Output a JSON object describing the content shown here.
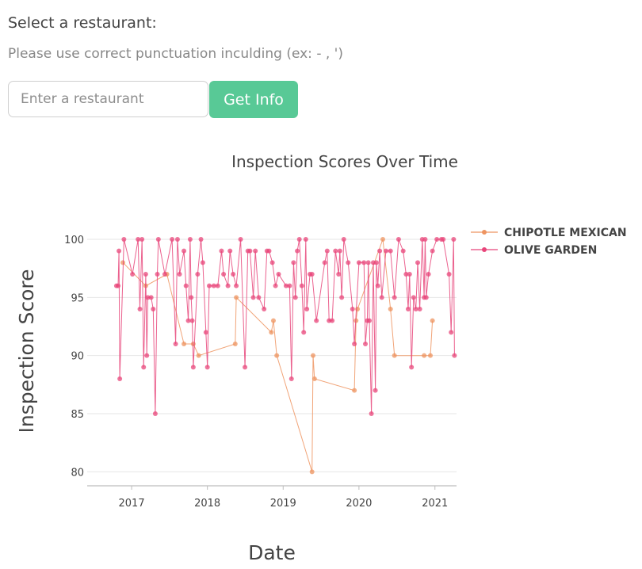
{
  "form": {
    "heading": "Select a restaurant:",
    "subheading": "Please use correct punctuation inculding (ex: - , ')",
    "search_placeholder": "Enter a restaurant",
    "button_label": "Get Info"
  },
  "colors": {
    "accent_button": "#58c996",
    "series_chipotle": "#ee9460",
    "series_olive": "#e8457a",
    "grid": "#e6e6e6",
    "axis": "#bdbdbd"
  },
  "chart_data": {
    "type": "line",
    "title": "Inspection Scores Over Time",
    "xlabel": "Date",
    "ylabel": "Inspection Score",
    "xlim": [
      "2016-06-01",
      "2021-04-15"
    ],
    "ylim": [
      79,
      101.5
    ],
    "yticks": [
      80,
      85,
      90,
      95,
      100
    ],
    "xticks": [
      "2017",
      "2018",
      "2019",
      "2020",
      "2021"
    ],
    "grid": "horizontal",
    "markers": true,
    "legend_position": "top-right",
    "series": [
      {
        "name": "CHIPOTLE MEXICAN",
        "color": "#ee9460",
        "points": [
          [
            "2016-11-20",
            98
          ],
          [
            "2017-03-10",
            96
          ],
          [
            "2017-06-20",
            97
          ],
          [
            "2017-09-10",
            91
          ],
          [
            "2017-10-25",
            91
          ],
          [
            "2017-11-20",
            90
          ],
          [
            "2018-05-15",
            91
          ],
          [
            "2018-05-20",
            95
          ],
          [
            "2018-11-05",
            92
          ],
          [
            "2018-11-15",
            93
          ],
          [
            "2018-12-01",
            90
          ],
          [
            "2019-05-20",
            80
          ],
          [
            "2019-05-25",
            90
          ],
          [
            "2019-06-01",
            88
          ],
          [
            "2019-12-10",
            87
          ],
          [
            "2019-12-18",
            93
          ],
          [
            "2019-12-25",
            94
          ],
          [
            "2020-04-25",
            100
          ],
          [
            "2020-06-01",
            94
          ],
          [
            "2020-06-20",
            90
          ],
          [
            "2020-11-10",
            90
          ],
          [
            "2020-12-10",
            90
          ],
          [
            "2020-12-20",
            93
          ]
        ]
      },
      {
        "name": "OLIVE GARDEN",
        "color": "#e8457a",
        "points": [
          [
            "2016-10-20",
            96
          ],
          [
            "2016-10-28",
            96
          ],
          [
            "2016-11-01",
            99
          ],
          [
            "2016-11-05",
            88
          ],
          [
            "2016-11-25",
            100
          ],
          [
            "2017-01-05",
            97
          ],
          [
            "2017-02-01",
            100
          ],
          [
            "2017-02-10",
            94
          ],
          [
            "2017-02-20",
            100
          ],
          [
            "2017-02-28",
            89
          ],
          [
            "2017-03-10",
            97
          ],
          [
            "2017-03-15",
            90
          ],
          [
            "2017-03-20",
            95
          ],
          [
            "2017-04-05",
            95
          ],
          [
            "2017-04-15",
            94
          ],
          [
            "2017-04-25",
            85
          ],
          [
            "2017-05-05",
            97
          ],
          [
            "2017-05-10",
            100
          ],
          [
            "2017-06-10",
            97
          ],
          [
            "2017-07-15",
            100
          ],
          [
            "2017-08-01",
            91
          ],
          [
            "2017-08-10",
            100
          ],
          [
            "2017-08-20",
            97
          ],
          [
            "2017-09-10",
            99
          ],
          [
            "2017-09-20",
            96
          ],
          [
            "2017-10-01",
            93
          ],
          [
            "2017-10-10",
            100
          ],
          [
            "2017-10-15",
            95
          ],
          [
            "2017-10-20",
            93
          ],
          [
            "2017-10-25",
            89
          ],
          [
            "2017-11-15",
            97
          ],
          [
            "2017-12-01",
            100
          ],
          [
            "2017-12-10",
            98
          ],
          [
            "2017-12-25",
            92
          ],
          [
            "2018-01-01",
            89
          ],
          [
            "2018-01-10",
            96
          ],
          [
            "2018-02-01",
            96
          ],
          [
            "2018-02-20",
            96
          ],
          [
            "2018-03-10",
            99
          ],
          [
            "2018-03-20",
            97
          ],
          [
            "2018-04-10",
            96
          ],
          [
            "2018-04-20",
            99
          ],
          [
            "2018-05-05",
            97
          ],
          [
            "2018-05-20",
            96
          ],
          [
            "2018-06-10",
            100
          ],
          [
            "2018-07-01",
            89
          ],
          [
            "2018-07-15",
            99
          ],
          [
            "2018-07-25",
            99
          ],
          [
            "2018-08-10",
            95
          ],
          [
            "2018-08-20",
            99
          ],
          [
            "2018-09-05",
            95
          ],
          [
            "2018-10-01",
            94
          ],
          [
            "2018-10-15",
            99
          ],
          [
            "2018-10-25",
            99
          ],
          [
            "2018-11-10",
            98
          ],
          [
            "2018-11-25",
            96
          ],
          [
            "2018-12-10",
            97
          ],
          [
            "2019-01-15",
            96
          ],
          [
            "2019-02-01",
            96
          ],
          [
            "2019-02-10",
            88
          ],
          [
            "2019-02-20",
            98
          ],
          [
            "2019-03-01",
            95
          ],
          [
            "2019-03-10",
            99
          ],
          [
            "2019-03-20",
            100
          ],
          [
            "2019-04-01",
            96
          ],
          [
            "2019-04-10",
            92
          ],
          [
            "2019-04-20",
            100
          ],
          [
            "2019-04-25",
            94
          ],
          [
            "2019-05-10",
            97
          ],
          [
            "2019-05-20",
            97
          ],
          [
            "2019-06-10",
            93
          ],
          [
            "2019-07-20",
            98
          ],
          [
            "2019-08-01",
            99
          ],
          [
            "2019-08-10",
            93
          ],
          [
            "2019-08-25",
            93
          ],
          [
            "2019-09-10",
            99
          ],
          [
            "2019-09-25",
            97
          ],
          [
            "2019-10-01",
            99
          ],
          [
            "2019-10-10",
            95
          ],
          [
            "2019-10-20",
            100
          ],
          [
            "2019-11-10",
            98
          ],
          [
            "2019-12-01",
            94
          ],
          [
            "2019-12-10",
            91
          ],
          [
            "2020-01-01",
            98
          ],
          [
            "2020-01-25",
            98
          ],
          [
            "2020-02-01",
            91
          ],
          [
            "2020-02-10",
            93
          ],
          [
            "2020-02-15",
            98
          ],
          [
            "2020-02-20",
            93
          ],
          [
            "2020-03-01",
            85
          ],
          [
            "2020-03-10",
            98
          ],
          [
            "2020-03-20",
            87
          ],
          [
            "2020-03-25",
            98
          ],
          [
            "2020-04-01",
            96
          ],
          [
            "2020-04-10",
            99
          ],
          [
            "2020-04-20",
            95
          ],
          [
            "2020-05-10",
            99
          ],
          [
            "2020-06-01",
            99
          ],
          [
            "2020-06-20",
            95
          ],
          [
            "2020-07-10",
            100
          ],
          [
            "2020-08-01",
            99
          ],
          [
            "2020-08-15",
            97
          ],
          [
            "2020-08-25",
            94
          ],
          [
            "2020-09-01",
            97
          ],
          [
            "2020-09-10",
            89
          ],
          [
            "2020-09-20",
            95
          ],
          [
            "2020-10-01",
            94
          ],
          [
            "2020-10-10",
            98
          ],
          [
            "2020-10-20",
            94
          ],
          [
            "2020-11-01",
            100
          ],
          [
            "2020-11-10",
            95
          ],
          [
            "2020-11-15",
            100
          ],
          [
            "2020-11-20",
            95
          ],
          [
            "2020-12-01",
            97
          ],
          [
            "2020-12-20",
            99
          ],
          [
            "2021-01-10",
            100
          ],
          [
            "2021-02-01",
            100
          ],
          [
            "2021-02-10",
            100
          ],
          [
            "2021-03-10",
            97
          ],
          [
            "2021-03-20",
            92
          ],
          [
            "2021-04-01",
            100
          ],
          [
            "2021-04-05",
            90
          ]
        ]
      }
    ]
  }
}
